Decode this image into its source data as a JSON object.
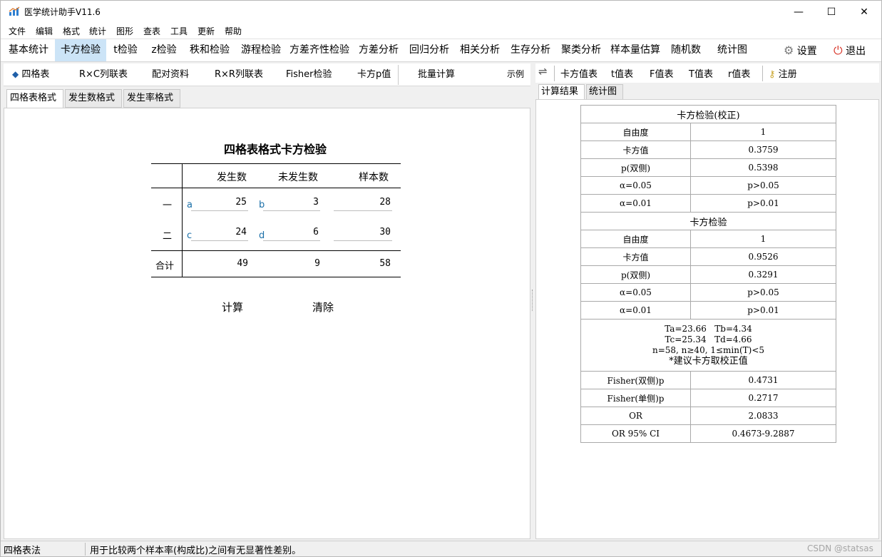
{
  "window": {
    "title": "医学统计助手V11.6",
    "min_glyph": "—",
    "max_glyph": "☐",
    "close_glyph": "✕"
  },
  "menu": [
    "文件",
    "编辑",
    "格式",
    "统计",
    "图形",
    "查表",
    "工具",
    "更新",
    "帮助"
  ],
  "main_tabs": [
    "基本统计",
    "卡方检验",
    "t检验",
    "z检验",
    "秩和检验",
    "游程检验",
    "方差齐性检验",
    "方差分析",
    "回归分析",
    "相关分析",
    "生存分析",
    "聚类分析",
    "样本量估算",
    "随机数",
    "统计图"
  ],
  "main_tabs_active": "卡方检验",
  "main_right": {
    "settings": "设置",
    "exit": "退出"
  },
  "sub_tabs": {
    "fourfold": "四格表",
    "rxc": "R×C列联表",
    "paired": "配对资料",
    "rxr": "R×R列联表",
    "fisher": "Fisher检验",
    "chip": "卡方p值",
    "batch": "批量计算",
    "example": "示例"
  },
  "format_tabs": [
    "四格表格式",
    "发生数格式",
    "发生率格式"
  ],
  "form": {
    "title": "四格表格式卡方检验",
    "col_headers": [
      "发生数",
      "未发生数",
      "样本数"
    ],
    "rows": [
      {
        "label": "一",
        "l1": "a",
        "v1": "25",
        "l2": "b",
        "v2": "3",
        "total": "28"
      },
      {
        "label": "二",
        "l1": "c",
        "v1": "24",
        "l2": "d",
        "v2": "6",
        "total": "30"
      }
    ],
    "total_row": {
      "label": "合计",
      "c1": "49",
      "c2": "9",
      "c3": "58"
    },
    "calc": "计算",
    "clear": "清除"
  },
  "right_toolbar": {
    "swap": "⇌",
    "chi": "卡方值表",
    "t": "t值表",
    "f": "F值表",
    "T": "T值表",
    "r": "r值表",
    "register": "注册"
  },
  "right_tabs": [
    "计算结果",
    "统计图"
  ],
  "results": {
    "corrected_title": "卡方检验(校正)",
    "corrected": [
      [
        "自由度",
        "1"
      ],
      [
        "卡方值",
        "0.3759"
      ],
      [
        "p(双侧)",
        "0.5398"
      ],
      [
        "α=0.05",
        "p>0.05"
      ],
      [
        "α=0.01",
        "p>0.01"
      ]
    ],
    "plain_title": "卡方检验",
    "plain": [
      [
        "自由度",
        "1"
      ],
      [
        "卡方值",
        "0.9526"
      ],
      [
        "p(双侧)",
        "0.3291"
      ],
      [
        "α=0.05",
        "p>0.05"
      ],
      [
        "α=0.01",
        "p>0.01"
      ]
    ],
    "note": [
      "Ta=23.66   Tb=4.34",
      "Tc=25.34   Td=4.66",
      "n=58, n≥40, 1≤min(T)<5",
      "*建议卡方取校正值"
    ],
    "extra": [
      [
        "Fisher(双侧)p",
        "0.4731"
      ],
      [
        "Fisher(单侧)p",
        "0.2717"
      ],
      [
        "OR",
        "2.0833"
      ],
      [
        "OR 95% CI",
        "0.4673-9.2887"
      ]
    ]
  },
  "status": {
    "left": "四格表法",
    "message": "用于比较两个样本率(构成比)之间有无显著性差别。",
    "watermark": "CSDN @statsas"
  }
}
